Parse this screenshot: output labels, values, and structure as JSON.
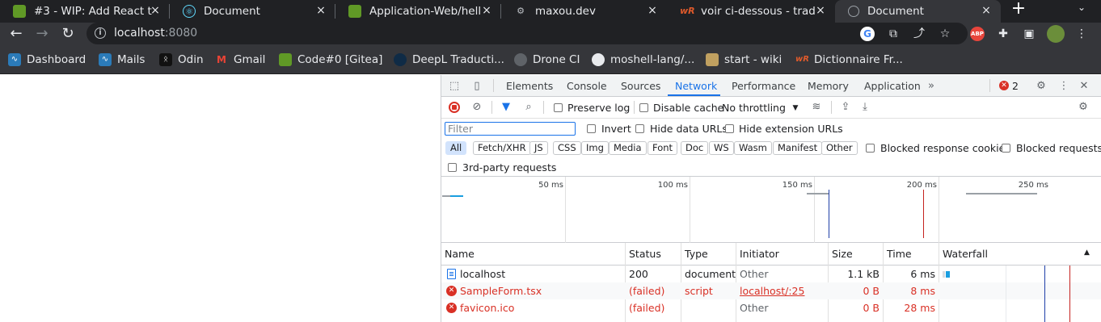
{
  "browser": {
    "tabs": [
      {
        "title": "#3 - WIP: Add React t",
        "icon": "gitea-icon",
        "color": "#609926"
      },
      {
        "title": "Document",
        "icon": "react-icon",
        "color": "#61dafb"
      },
      {
        "title": "Application-Web/hello",
        "icon": "gitea-icon",
        "color": "#609926"
      },
      {
        "title": "maxou.dev",
        "icon": "gear-icon",
        "color": "#bdc1c6"
      },
      {
        "title": "voir ci-dessous - trad",
        "icon": "wordreference-icon",
        "color": "#e05a2b"
      },
      {
        "title": "Document",
        "icon": "globe-icon",
        "color": "#9aa0a6"
      }
    ],
    "new_tab_symbol": "+",
    "tab_close_symbol": "×",
    "address": {
      "host": "localhost",
      "port": ":8080"
    },
    "bookmarks": [
      {
        "label": "Dashboard",
        "icon": "dashboard-icon",
        "color": "#2b7bb9"
      },
      {
        "label": "Mails",
        "icon": "mail-icon",
        "color": "#2b7bb9"
      },
      {
        "label": "Odin",
        "icon": "odin-icon",
        "color": "#111111"
      },
      {
        "label": "Gmail",
        "icon": "gmail-icon",
        "color": "#ea4335"
      },
      {
        "label": "Code#0 [Gitea]",
        "icon": "gitea-icon",
        "color": "#609926"
      },
      {
        "label": "DeepL Traducti...",
        "icon": "deepl-icon",
        "color": "#0f2b46"
      },
      {
        "label": "Drone CI",
        "icon": "drone-icon",
        "color": "#5f6368"
      },
      {
        "label": "moshell-lang/...",
        "icon": "github-icon",
        "color": "#e8eaed"
      },
      {
        "label": "start - wiki",
        "icon": "dokuwiki-icon",
        "color": "#c0a060"
      },
      {
        "label": "Dictionnaire Fr...",
        "icon": "wordreference-icon",
        "color": "#e05a2b"
      }
    ]
  },
  "devtools": {
    "tabs": [
      "Elements",
      "Console",
      "Sources",
      "Network",
      "Performance",
      "Memory",
      "Application"
    ],
    "active_tab": "Network",
    "error_count": "2",
    "toolbar": {
      "preserve_log": "Preserve log",
      "disable_cache": "Disable cache",
      "throttling": "No throttling"
    },
    "filter": {
      "placeholder": "Filter",
      "invert": "Invert",
      "hide_data_urls": "Hide data URLs",
      "hide_extension_urls": "Hide extension URLs"
    },
    "type_filters": [
      "All",
      "Fetch/XHR",
      "JS",
      "CSS",
      "Img",
      "Media",
      "Font",
      "Doc",
      "WS",
      "Wasm",
      "Manifest",
      "Other"
    ],
    "blocked_response_cookies": "Blocked response cookies",
    "blocked_requests": "Blocked requests",
    "third_party": "3rd-party requests",
    "overview_ticks": [
      "50 ms",
      "100 ms",
      "150 ms",
      "200 ms",
      "250 ms"
    ],
    "columns": [
      "Name",
      "Status",
      "Type",
      "Initiator",
      "Size",
      "Time",
      "Waterfall"
    ],
    "requests": [
      {
        "name": "localhost",
        "status": "200",
        "type": "document",
        "initiator": "Other",
        "size": "1.1 kB",
        "time": "6 ms",
        "failed": false
      },
      {
        "name": "SampleForm.tsx",
        "status": "(failed)",
        "type": "script",
        "initiator": "localhost/:25",
        "size": "0 B",
        "time": "8 ms",
        "failed": true
      },
      {
        "name": "favicon.ico",
        "status": "(failed)",
        "type": "",
        "initiator": "Other",
        "size": "0 B",
        "time": "28 ms",
        "failed": true
      }
    ]
  },
  "colors": {
    "accent": "#1a73e8",
    "error": "#d93025",
    "chrome_dark": "#202124",
    "chrome_toolbar": "#35363a"
  }
}
